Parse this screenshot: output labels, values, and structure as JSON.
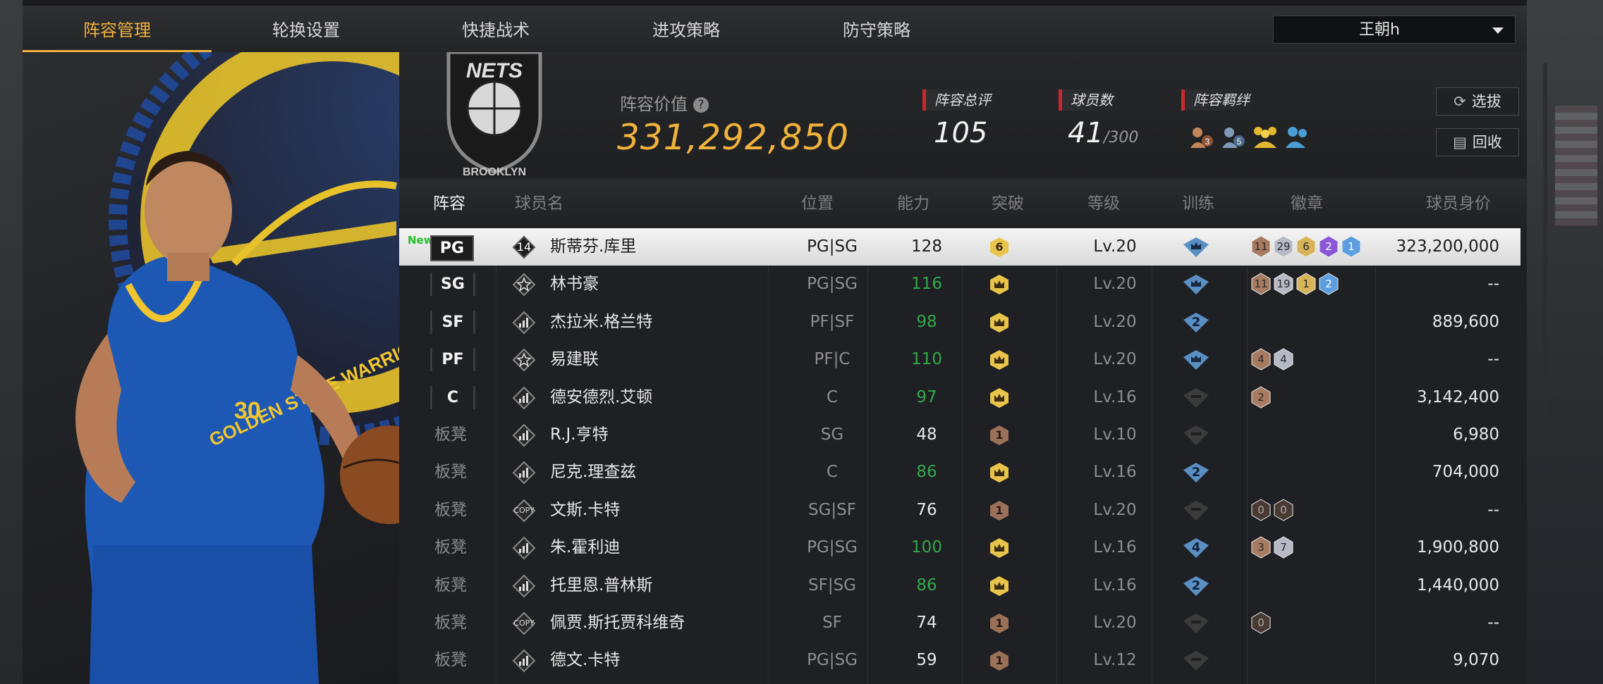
{
  "tabs": [
    {
      "label": "阵容管理",
      "active": true
    },
    {
      "label": "轮换设置",
      "active": false
    },
    {
      "label": "快捷战术",
      "active": false
    },
    {
      "label": "进攻策略",
      "active": false
    },
    {
      "label": "防守策略",
      "active": false
    }
  ],
  "team_selector": {
    "value": "王朝h"
  },
  "header": {
    "team_logo_text": "NETS",
    "team_logo_sub": "BROOKLYN",
    "lineup_value_label": "阵容价值",
    "help_glyph": "?",
    "lineup_value": "331,292,850",
    "overall_label": "阵容总评",
    "overall_value": "105",
    "players_label": "球员数",
    "players_value": "41",
    "players_max": "/300",
    "bonds_label": "阵容羁绊",
    "bond_icons": [
      {
        "name": "bond-3-icon",
        "num": "3",
        "color": "#c2855a"
      },
      {
        "name": "bond-5-icon",
        "num": "5",
        "color": "#7f9ab8"
      },
      {
        "name": "bond-group-icon",
        "num": "",
        "color": "#e3b830"
      },
      {
        "name": "bond-pair-icon",
        "num": "",
        "color": "#4a9ed6"
      }
    ],
    "draft_button": "选拔",
    "recycle_button": "回收"
  },
  "columns": [
    "阵容",
    "球员名",
    "位置",
    "能力",
    "突破",
    "等级",
    "训练",
    "徽章",
    "球员身价"
  ],
  "players": [
    {
      "slot": "PG",
      "new": "New",
      "icon": "14",
      "name": "斯蒂芬.库里",
      "position": "PG|SG",
      "ability": "128",
      "ability_color": "normal",
      "breakthrough": "6",
      "bt_type": "num",
      "level": "Lv.20",
      "training": "crown",
      "badges": [
        {
          "n": "11",
          "c": "bronze"
        },
        {
          "n": "29",
          "c": "silver"
        },
        {
          "n": "6",
          "c": "gold"
        },
        {
          "n": "2",
          "c": "purple"
        },
        {
          "n": "1",
          "c": "blue"
        }
      ],
      "price": "323,200,000",
      "selected": true
    },
    {
      "slot": "SG",
      "new": "",
      "icon": "star",
      "name": "林书豪",
      "position": "PG|SG",
      "ability": "116",
      "ability_color": "green",
      "breakthrough": "",
      "bt_type": "crown",
      "level": "Lv.20",
      "training": "crown",
      "badges": [
        {
          "n": "11",
          "c": "bronze"
        },
        {
          "n": "19",
          "c": "silver"
        },
        {
          "n": "1",
          "c": "gold"
        },
        {
          "n": "2",
          "c": "blue"
        }
      ],
      "price": "--",
      "selected": false
    },
    {
      "slot": "SF",
      "new": "",
      "icon": "bars",
      "name": "杰拉米.格兰特",
      "position": "PF|SF",
      "ability": "98",
      "ability_color": "green",
      "breakthrough": "",
      "bt_type": "crown",
      "level": "Lv.20",
      "training": "2",
      "badges": [],
      "price": "889,600",
      "selected": false
    },
    {
      "slot": "PF",
      "new": "",
      "icon": "star",
      "name": "易建联",
      "position": "PF|C",
      "ability": "110",
      "ability_color": "green",
      "breakthrough": "",
      "bt_type": "crown",
      "level": "Lv.20",
      "training": "crown",
      "badges": [
        {
          "n": "4",
          "c": "bronze"
        },
        {
          "n": "4",
          "c": "silver"
        }
      ],
      "price": "--",
      "selected": false
    },
    {
      "slot": "C",
      "new": "",
      "icon": "bars",
      "name": "德安德烈.艾顿",
      "position": "C",
      "ability": "97",
      "ability_color": "green",
      "breakthrough": "",
      "bt_type": "crown",
      "level": "Lv.16",
      "training": "dash",
      "badges": [
        {
          "n": "2",
          "c": "bronze"
        }
      ],
      "price": "3,142,400",
      "selected": false
    },
    {
      "slot": "板凳",
      "new": "",
      "icon": "bars",
      "name": "R.J.亨特",
      "position": "SG",
      "ability": "48",
      "ability_color": "normal",
      "breakthrough": "1",
      "bt_type": "num1",
      "level": "Lv.10",
      "training": "dash",
      "badges": [],
      "price": "6,980",
      "selected": false
    },
    {
      "slot": "板凳",
      "new": "",
      "icon": "bars",
      "name": "尼克.理查兹",
      "position": "C",
      "ability": "86",
      "ability_color": "green",
      "breakthrough": "",
      "bt_type": "crown",
      "level": "Lv.16",
      "training": "2",
      "badges": [],
      "price": "704,000",
      "selected": false
    },
    {
      "slot": "板凳",
      "new": "",
      "icon": "COPY",
      "name": "文斯.卡特",
      "position": "SG|SF",
      "ability": "76",
      "ability_color": "normal",
      "breakthrough": "1",
      "bt_type": "num1",
      "level": "Lv.20",
      "training": "dash",
      "badges": [
        {
          "n": "0",
          "c": "dark"
        },
        {
          "n": "0",
          "c": "dark"
        }
      ],
      "price": "--",
      "selected": false
    },
    {
      "slot": "板凳",
      "new": "",
      "icon": "bars",
      "name": "朱.霍利迪",
      "position": "PG|SG",
      "ability": "100",
      "ability_color": "green",
      "breakthrough": "",
      "bt_type": "crown",
      "level": "Lv.16",
      "training": "4",
      "badges": [
        {
          "n": "3",
          "c": "bronze"
        },
        {
          "n": "7",
          "c": "silver"
        }
      ],
      "price": "1,900,800",
      "selected": false
    },
    {
      "slot": "板凳",
      "new": "",
      "icon": "bars",
      "name": "托里恩.普林斯",
      "position": "SF|SG",
      "ability": "86",
      "ability_color": "green",
      "breakthrough": "",
      "bt_type": "crown",
      "level": "Lv.16",
      "training": "2",
      "badges": [],
      "price": "1,440,000",
      "selected": false
    },
    {
      "slot": "板凳",
      "new": "",
      "icon": "COPY",
      "name": "佩贾.斯托贾科维奇",
      "position": "SF",
      "ability": "74",
      "ability_color": "normal",
      "breakthrough": "1",
      "bt_type": "num1",
      "level": "Lv.20",
      "training": "dash",
      "badges": [
        {
          "n": "0",
          "c": "dark"
        }
      ],
      "price": "--",
      "selected": false
    },
    {
      "slot": "板凳",
      "new": "",
      "icon": "bars",
      "name": "德文.卡特",
      "position": "PG|SG",
      "ability": "59",
      "ability_color": "normal",
      "breakthrough": "1",
      "bt_type": "num1",
      "level": "Lv.12",
      "training": "dash",
      "badges": [],
      "price": "9,070",
      "selected": false
    }
  ],
  "art": {
    "jersey_text": "GOLDEN STATE WARRIORS",
    "number": "30"
  },
  "colors": {
    "accent": "#f0b23c",
    "green": "#32a84a",
    "tag_red": "#c8282e",
    "training_blue": "#5a8fc4"
  }
}
